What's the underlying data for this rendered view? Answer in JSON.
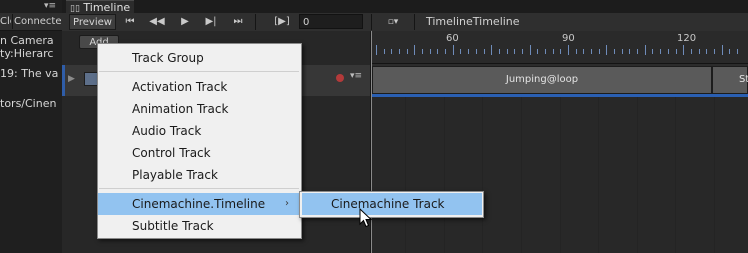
{
  "console": {
    "top_icon": "▾≡",
    "tabs": [
      "Clear",
      "Connecte"
    ],
    "lines": [
      "n Camera",
      "ty:Hierarc",
      "19: The va",
      "tors/Cinen"
    ]
  },
  "timeline_tab": {
    "icon": "timeline-icon",
    "label": "Timeline"
  },
  "toolbar": {
    "preview_label": "Preview",
    "frame_value": "0",
    "title": "TimelineTimeline",
    "add_label": "Add",
    "range_icon": "[▶]"
  },
  "ruler": {
    "labels": [
      "60",
      "90",
      "120"
    ]
  },
  "clips": {
    "main": "Jumping@loop",
    "next": "St"
  },
  "menu": {
    "items": [
      {
        "label": "Track Group"
      },
      {
        "label": "Activation Track"
      },
      {
        "label": "Animation Track"
      },
      {
        "label": "Audio Track"
      },
      {
        "label": "Control Track"
      },
      {
        "label": "Playable Track"
      },
      {
        "label": "Cinemachine.Timeline",
        "arrow": "›"
      },
      {
        "label": "Subtitle Track"
      }
    ]
  },
  "submenu": {
    "items": [
      {
        "label": "Cinemachine Track"
      }
    ]
  },
  "colors": {
    "selection": "#92c3f0",
    "track_accent": "#2f5da8",
    "record_dot": "#b33a3a"
  }
}
